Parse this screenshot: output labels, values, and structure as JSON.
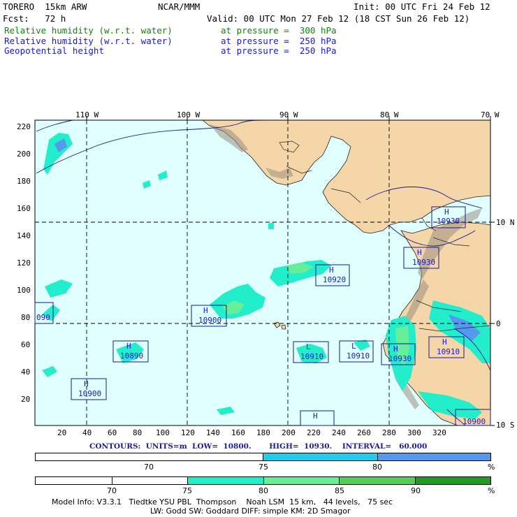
{
  "header": {
    "model": "TORERO  15km ARW",
    "org": "NCAR/MMM",
    "init": "Init: 00 UTC Fri 24 Feb 12",
    "fcst": "Fcst:   72 h",
    "valid": "Valid: 00 UTC Mon 27 Feb 12 (18 CST Sun 26 Feb 12)",
    "fields": [
      {
        "name": "Relative humidity (w.r.t. water)",
        "level": "at pressure =  300 hPa",
        "color": "#0a8a0a"
      },
      {
        "name": "Relative humidity (w.r.t. water)",
        "level": "at pressure =  250 hPa",
        "color": "#1a1ad0"
      },
      {
        "name": "Geopotential height",
        "level": "at pressure =  250 hPa",
        "color": "#1a1ad0"
      }
    ]
  },
  "map": {
    "ocean_color": "#e0ffff",
    "land_color": "#f5d6a8",
    "top_lon_labels": [
      "110 W",
      "100 W",
      "90 W",
      "80 W",
      "70 W"
    ],
    "right_lat_labels": [
      "10 N",
      "0",
      "10 S"
    ],
    "left_ticks": [
      "220",
      "200",
      "180",
      "160",
      "140",
      "120",
      "100",
      "80",
      "60",
      "40",
      "20"
    ],
    "bottom_ticks": [
      "20",
      "40",
      "60",
      "80",
      "100",
      "120",
      "140",
      "160",
      "180",
      "200",
      "220",
      "240",
      "260",
      "280",
      "300",
      "320"
    ],
    "height_labels": [
      {
        "id": "h1",
        "letter": "H",
        "value": "10930"
      },
      {
        "id": "h2",
        "letter": "H",
        "value": "10930"
      },
      {
        "id": "h3",
        "letter": "H",
        "value": "10920"
      },
      {
        "id": "h4",
        "letter": "",
        "value": "090"
      },
      {
        "id": "h5",
        "letter": "H",
        "value": "10900"
      },
      {
        "id": "h6",
        "letter": "H",
        "value": "10890"
      },
      {
        "id": "h7",
        "letter": "L",
        "value": "10910"
      },
      {
        "id": "h8",
        "letter": "L",
        "value": "10910"
      },
      {
        "id": "h9",
        "letter": "H",
        "value": "10930"
      },
      {
        "id": "h10",
        "letter": "H",
        "value": "10910"
      },
      {
        "id": "h11",
        "letter": "H",
        "value": "10900"
      },
      {
        "id": "h12",
        "letter": "H",
        "value": ""
      },
      {
        "id": "h13",
        "letter": "",
        "value": "10900"
      }
    ]
  },
  "contours": {
    "text": "CONTOURS:  UNITS=m  LOW=  10800.       HIGH=  10930.    INTERVAL=   60.000"
  },
  "colorbar_250": {
    "labels": [
      "70",
      "75",
      "80",
      "%"
    ],
    "colors": [
      "#ffffff",
      "#22ccee",
      "#5599ee"
    ]
  },
  "colorbar_300": {
    "labels": [
      "70",
      "75",
      "80",
      "85",
      "90",
      "%"
    ],
    "colors": [
      "#ffffff",
      "#ffffff",
      "#22eecc",
      "#66ee99",
      "#55cc55",
      "#229922"
    ]
  },
  "footer": {
    "line1": "Model Info: V3.3.1   Tiedtke YSU PBL  Thompson    Noah LSM  15 km,   44 levels,   75 sec",
    "line2": "LW: Godd SW: Goddard DIFF: simple KM: 2D Smagor"
  }
}
